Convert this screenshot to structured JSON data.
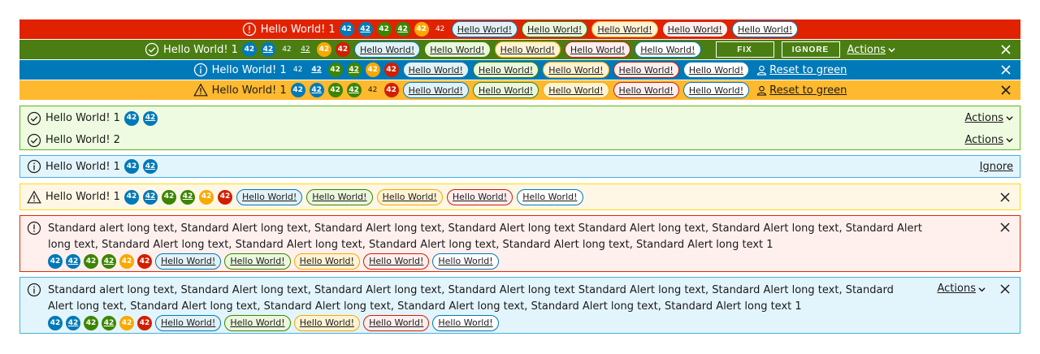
{
  "banners": {
    "danger": {
      "text": "Hello World! 1",
      "badges": [
        "42",
        "42",
        "42",
        "42",
        "42",
        "42"
      ],
      "labels": [
        "Hello World!",
        "Hello World!",
        "Hello World!",
        "Hello World!",
        "Hello World!"
      ]
    },
    "success": {
      "text": "Hello World! 1",
      "badges": [
        "42",
        "42",
        "42",
        "42",
        "42",
        "42"
      ],
      "labels": [
        "Hello World!",
        "Hello World!",
        "Hello World!",
        "Hello World!",
        "Hello World!"
      ],
      "fix_label": "FIX",
      "ignore_label": "IGNORE",
      "actions_label": "Actions"
    },
    "info": {
      "text": "Hello World! 1",
      "badges": [
        "42",
        "42",
        "42",
        "42",
        "42",
        "42"
      ],
      "labels": [
        "Hello World!",
        "Hello World!",
        "Hello World!",
        "Hello World!",
        "Hello World!"
      ],
      "reset_label": "Reset to green"
    },
    "warning": {
      "text": "Hello World! 1",
      "badges": [
        "42",
        "42",
        "42",
        "42",
        "42",
        "42"
      ],
      "labels": [
        "Hello World!",
        "Hello World!",
        "Hello World!",
        "Hello World!",
        "Hello World!"
      ],
      "reset_label": "Reset to green"
    }
  },
  "alerts": {
    "success": {
      "item1_text": "Hello World! 1",
      "item1_badges": [
        "42",
        "42"
      ],
      "item2_text": "Hello World! 2",
      "actions_label": "Actions"
    },
    "info": {
      "text": "Hello World! 1",
      "badges": [
        "42",
        "42"
      ],
      "ignore_label": "Ignore"
    },
    "warning": {
      "text": "Hello World! 1",
      "badges": [
        "42",
        "42",
        "42",
        "42",
        "42",
        "42"
      ],
      "labels": [
        "Hello World!",
        "Hello World!",
        "Hello World!",
        "Hello World!",
        "Hello World!"
      ]
    },
    "danger_long": {
      "text": "Standard alert long text, Standard Alert long text, Standard Alert long text, Standard Alert long text Standard Alert long text, Standard Alert long text, Standard Alert long text, Standard Alert long text, Standard Alert long text, Standard Alert long text, Standard Alert long text, Standard Alert long text 1",
      "badges": [
        "42",
        "42",
        "42",
        "42",
        "42",
        "42"
      ],
      "labels": [
        "Hello World!",
        "Hello World!",
        "Hello World!",
        "Hello World!",
        "Hello World!"
      ]
    },
    "info_long": {
      "text": "Standard alert long text, Standard Alert long text, Standard Alert long text, Standard Alert long text Standard Alert long text, Standard Alert long text, Standard Alert long text, Standard Alert long text, Standard Alert long text, Standard Alert long text, Standard Alert long text, Standard Alert long text 1",
      "badges": [
        "42",
        "42",
        "42",
        "42",
        "42",
        "42"
      ],
      "labels": [
        "Hello World!",
        "Hello World!",
        "Hello World!",
        "Hello World!",
        "Hello World!"
      ],
      "actions_label": "Actions"
    }
  },
  "colors": {
    "danger": "#e12200",
    "success": "#4a7e12",
    "info": "#0079b8",
    "warning": "#ffb92e"
  },
  "icons": [
    "error-standard-icon",
    "success-standard-icon",
    "info-standard-icon",
    "warning-standard-icon",
    "close-icon",
    "user-icon",
    "chevron-down-icon"
  ]
}
